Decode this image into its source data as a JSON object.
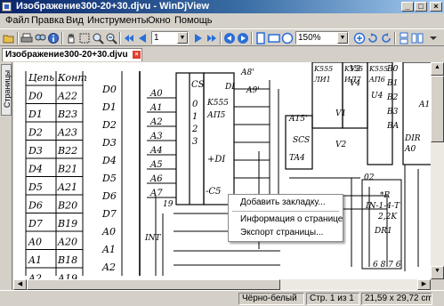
{
  "window": {
    "title": "Изображение300-20+30.djvu - WinDjView",
    "controls": {
      "minimize": "_",
      "maximize": "□",
      "close": "×"
    }
  },
  "menu": {
    "items": [
      "Файл",
      "Правка",
      "Вид",
      "Инструменты",
      "Окно",
      "Помощь"
    ]
  },
  "toolbar": {
    "page_number": "1",
    "zoom": "150%",
    "icons": [
      "open-icon",
      "print-icon",
      "find-icon",
      "info-icon",
      "hand-tool-icon",
      "select-tool-icon",
      "zoom-rect-icon",
      "zoom-in-tool-icon",
      "first-page-icon",
      "prev-page-icon",
      "next-page-icon",
      "last-page-icon",
      "back-icon",
      "forward-icon",
      "fit-page-icon",
      "fit-width-icon",
      "actual-size-icon",
      "zoom-out-icon",
      "zoom-in-icon",
      "rotate-left-icon",
      "rotate-right-icon",
      "continuous-icon",
      "facing-icon"
    ]
  },
  "tabs": [
    {
      "label": "Изображение300-20+30.djvu",
      "close": "×"
    }
  ],
  "sidebar": {
    "tab_label": "Страницы"
  },
  "context_menu": {
    "items": [
      {
        "label": "Добавить закладку..."
      },
      {
        "label": "Информация о странице"
      },
      {
        "label": "Экспорт страницы..."
      }
    ]
  },
  "document": {
    "left_column_labels": [
      "Цепь",
      "D0",
      "D1",
      "D2",
      "D3",
      "D4",
      "D5",
      "D6",
      "D7",
      "A0",
      "A1",
      "A2"
    ],
    "contact_labels": [
      "Конт",
      "A22",
      "B23",
      "A23",
      "B22",
      "B21",
      "A21",
      "B20",
      "B19",
      "A20",
      "B18",
      "A19"
    ],
    "bus_labels": [
      "D0",
      "D1",
      "D2",
      "D3",
      "D4",
      "D5",
      "D6",
      "D7",
      "A0",
      "A1",
      "A2"
    ],
    "chip_labels": [
      "K555",
      "АП5",
      "K555",
      "ЛИ1",
      "K555",
      "ИД7",
      "K555",
      "AП6",
      "U4"
    ],
    "pin_labels": [
      "A0",
      "A1",
      "A2",
      "A3",
      "A4",
      "A5",
      "A6",
      "A7",
      "0",
      "1",
      "2",
      "3",
      "CS",
      "+DI",
      "-C5",
      "02"
    ],
    "misc_labels": [
      "19",
      "INT",
      "DI",
      "*R",
      "2,2K",
      "IN-1-4-Т",
      "DR1",
      "A8'",
      "A9'",
      "A15'",
      "TA4",
      "SCS",
      "V1",
      "V2",
      "V3",
      "V4",
      "B0",
      "B1",
      "B2",
      "B3",
      "BA",
      "DIR",
      "A0",
      "A1",
      "6 8 7 6"
    ]
  },
  "status": {
    "mode": "Чёрно-белый",
    "page": "Стр. 1 из 1",
    "size": "21,59 x 29,72 cm"
  }
}
